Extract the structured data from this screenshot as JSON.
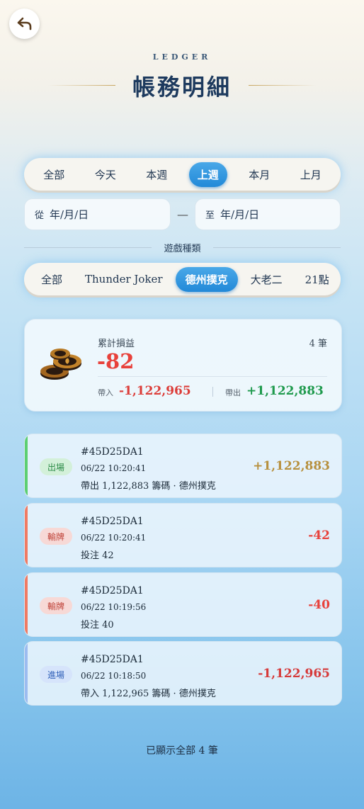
{
  "header": {
    "eyebrow": "LEDGER",
    "title": "帳務明細"
  },
  "period_tabs": [
    {
      "label": "全部",
      "active": false
    },
    {
      "label": "今天",
      "active": false
    },
    {
      "label": "本週",
      "active": false
    },
    {
      "label": "上週",
      "active": true
    },
    {
      "label": "本月",
      "active": false
    },
    {
      "label": "上月",
      "active": false
    }
  ],
  "date_range": {
    "from_prefix": "從",
    "from_placeholder": "年/月/日",
    "separator": "—",
    "to_prefix": "至",
    "to_placeholder": "年/月/日"
  },
  "game_type": {
    "label": "遊戲種類",
    "tabs": [
      {
        "label": "全部",
        "active": false
      },
      {
        "label": "Thunder Joker",
        "active": false
      },
      {
        "label": "德州撲克",
        "active": true
      },
      {
        "label": "大老二",
        "active": false
      },
      {
        "label": "21點",
        "active": false
      }
    ]
  },
  "summary": {
    "label": "累計損益",
    "count": "4 筆",
    "value": "-82",
    "in_label": "帶入",
    "in_value": "-1,122,965",
    "out_label": "帶出",
    "out_value": "+1,122,883"
  },
  "records": [
    {
      "badge": "出場",
      "id": "#45D25DA1",
      "time": "06/22 10:20:41",
      "desc": "帶出 1,122,883 籌碼 · 德州撲克",
      "amount": "+1,122,883",
      "accent": "#5ccf72",
      "badge_bg": "#d3f0d9",
      "badge_color": "#2a8a45",
      "amount_color": "#b7903e"
    },
    {
      "badge": "輸牌",
      "id": "#45D25DA1",
      "time": "06/22 10:20:41",
      "desc": "投注 42",
      "amount": "-42",
      "accent": "#f07a63",
      "badge_bg": "#f7d9d6",
      "badge_color": "#c0443a",
      "amount_color": "#e8413b"
    },
    {
      "badge": "輸牌",
      "id": "#45D25DA1",
      "time": "06/22 10:19:56",
      "desc": "投注 40",
      "amount": "-40",
      "accent": "#f07a63",
      "badge_bg": "#f7d9d6",
      "badge_color": "#c0443a",
      "amount_color": "#e8413b"
    },
    {
      "badge": "進場",
      "id": "#45D25DA1",
      "time": "06/22 10:18:50",
      "desc": "帶入 1,122,965 籌碼 · 德州撲克",
      "amount": "-1,122,965",
      "accent": "#9cbcf0",
      "badge_bg": "#d6e4fb",
      "badge_color": "#2f5fb8",
      "amount_color": "#d63a3a"
    }
  ],
  "footer": "已顯示全部 4 筆",
  "icons": {
    "back": "back-arrow-icon",
    "chips": "poker-chips-icon"
  },
  "colors": {
    "accent_blue": "#2289d8",
    "loss_red": "#e8413b",
    "gain_green": "#1f9a4d",
    "gold": "#c7a55f"
  }
}
